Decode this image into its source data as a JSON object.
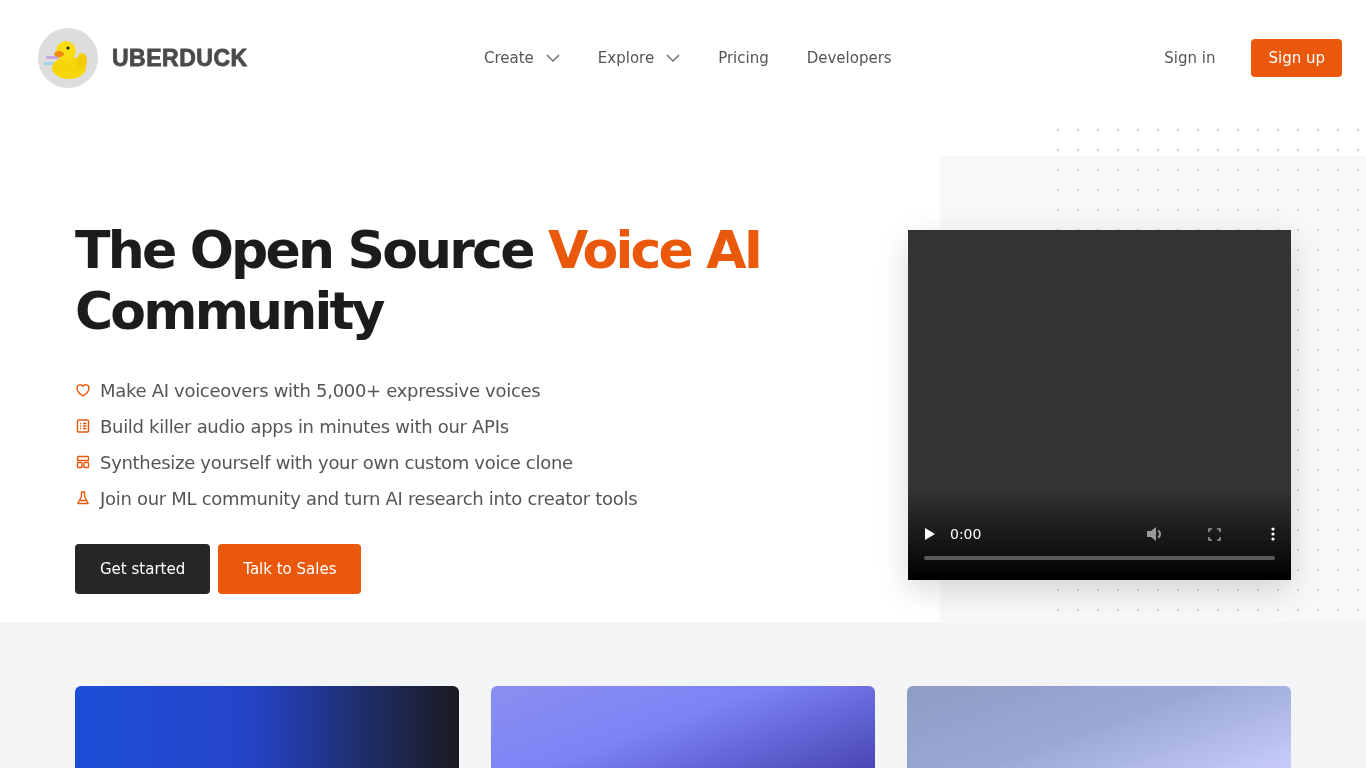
{
  "header": {
    "brand": "UBERDUCK",
    "nav": [
      {
        "label": "Create",
        "dropdown": true
      },
      {
        "label": "Explore",
        "dropdown": true
      },
      {
        "label": "Pricing",
        "dropdown": false
      },
      {
        "label": "Developers",
        "dropdown": false
      }
    ],
    "sign_in": "Sign in",
    "sign_up": "Sign up"
  },
  "hero": {
    "title_before": "The Open Source",
    "title_highlight": "Voice AI",
    "title_after": "Community",
    "features": [
      {
        "kind": "heart",
        "text": "Make AI voiceovers with 5,000+ expressive voices"
      },
      {
        "kind": "list",
        "text": "Build killer audio apps in minutes with our APIs"
      },
      {
        "kind": "layout",
        "text": "Synthesize yourself with your own custom voice clone"
      },
      {
        "kind": "flask",
        "text": "Join our ML community and turn AI research into creator tools"
      }
    ],
    "buttons": [
      {
        "label": "Get started",
        "kind": "dark"
      },
      {
        "label": "Talk to Sales",
        "kind": "accent"
      }
    ],
    "video": {
      "time": "0:00"
    }
  },
  "cards": [
    {
      "kind": "blue"
    },
    {
      "kind": "violet"
    },
    {
      "kind": "lavender"
    }
  ]
}
